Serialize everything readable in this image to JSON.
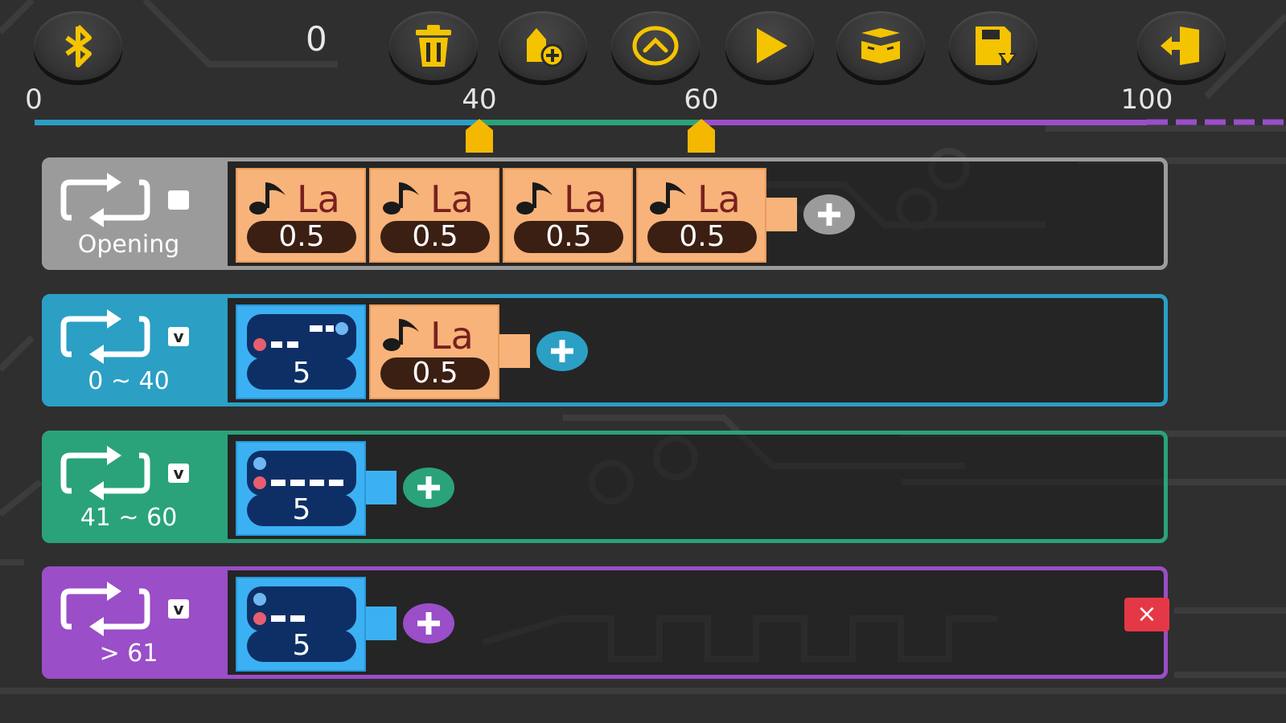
{
  "toolbar": {
    "counter": "0",
    "buttons": [
      {
        "icon": "bluetooth-icon"
      },
      {
        "icon": "trash-icon"
      },
      {
        "icon": "add-row-icon"
      },
      {
        "icon": "collapse-up-icon"
      },
      {
        "icon": "play-icon"
      },
      {
        "icon": "open-box-icon"
      },
      {
        "icon": "save-icon"
      },
      {
        "icon": "exit-icon"
      }
    ]
  },
  "range": {
    "ticks": [
      "0",
      "40",
      "60",
      "100"
    ],
    "handles": [
      40,
      60
    ]
  },
  "rows": [
    {
      "label": "Opening",
      "check": "",
      "color": "#9b9b9b",
      "blocks": [
        {
          "type": "note",
          "name": "La",
          "value": "0.5"
        },
        {
          "type": "note",
          "name": "La",
          "value": "0.5"
        },
        {
          "type": "note",
          "name": "La",
          "value": "0.5"
        },
        {
          "type": "note",
          "name": "La",
          "value": "0.5"
        }
      ]
    },
    {
      "label": "0 ~ 40",
      "check": "v",
      "color": "#2b9fc4",
      "blocks": [
        {
          "type": "light",
          "value": "5"
        },
        {
          "type": "note",
          "name": "La",
          "value": "0.5"
        }
      ]
    },
    {
      "label": "41 ~ 60",
      "check": "v",
      "color": "#2aa37a",
      "blocks": [
        {
          "type": "light",
          "value": "5"
        }
      ]
    },
    {
      "label": "> 61",
      "check": "v",
      "color": "#9a4ec7",
      "blocks": [
        {
          "type": "light",
          "value": "5"
        }
      ]
    }
  ],
  "colors": {
    "accent": "#f5b800",
    "cyan": "#2b9fc4",
    "green": "#2aa37a",
    "purple": "#9a4ec7",
    "grey": "#9b9b9b",
    "note": "#f7b37a",
    "light": "#3bb1f3",
    "delete": "#e53846"
  },
  "delete_button": {
    "label": "×"
  }
}
